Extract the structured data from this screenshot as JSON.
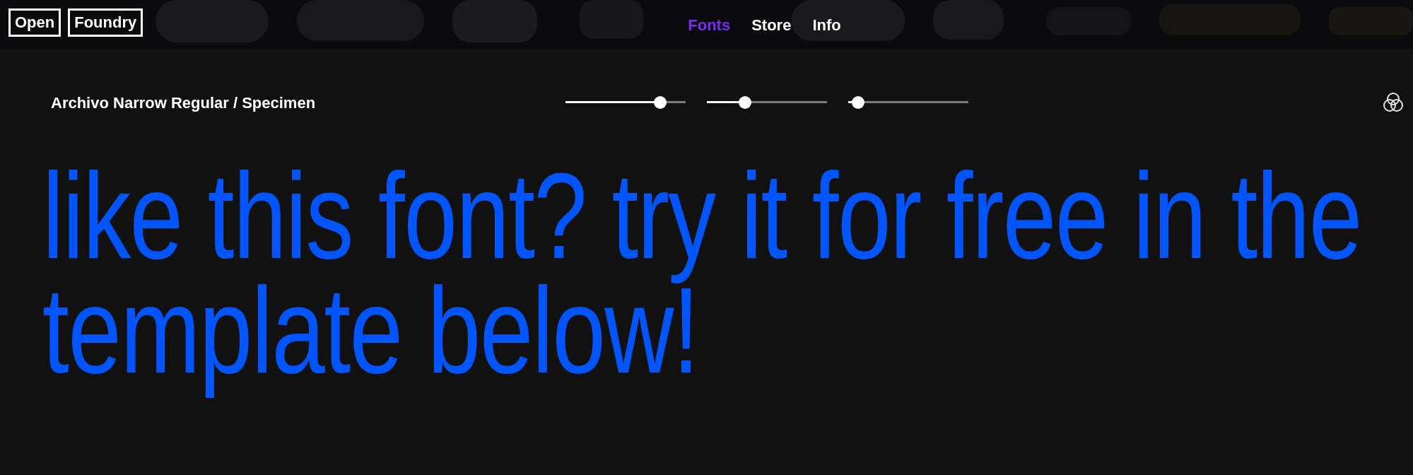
{
  "header": {
    "logo": [
      "Open",
      "Foundry"
    ],
    "nav": [
      {
        "label": "Fonts",
        "selected": true
      },
      {
        "label": "Store",
        "selected": false
      },
      {
        "label": "Info",
        "selected": false
      }
    ],
    "background": {
      "kind": "picture"
    }
  },
  "toolbar": {
    "title": "Archivo Narrow Regular / Specimen",
    "sliders": [
      {
        "level": 0.79
      },
      {
        "level": 0.32
      },
      {
        "level": 0.08
      }
    ]
  },
  "specimen": {
    "text": "like this font? try it for free in the template below!"
  }
}
